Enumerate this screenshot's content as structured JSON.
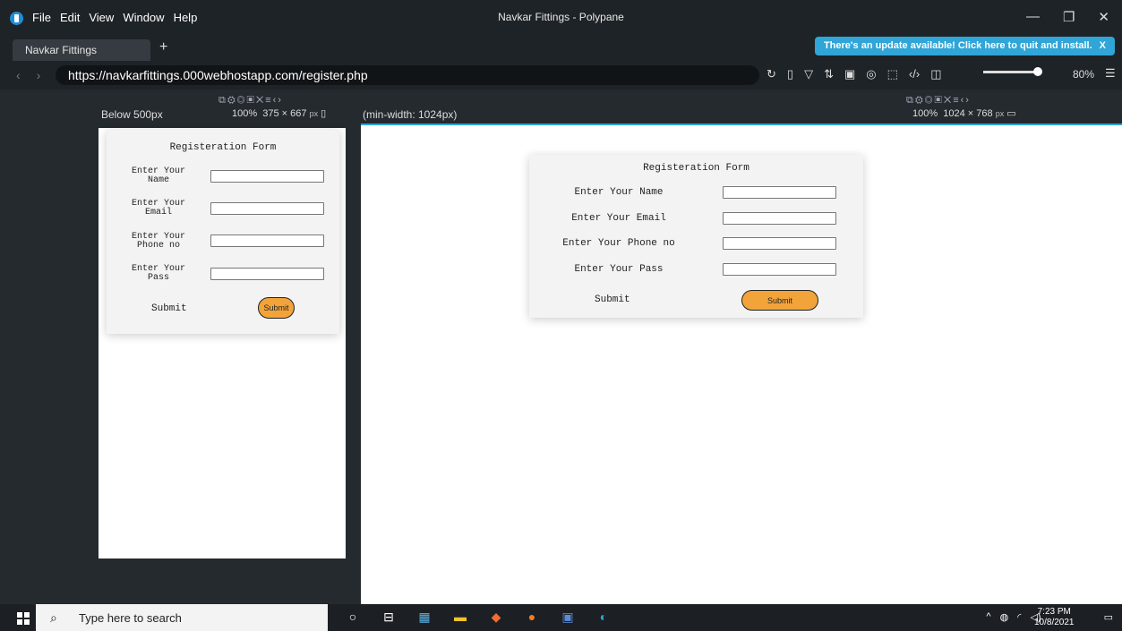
{
  "window": {
    "title": "Navkar Fittings - Polypane"
  },
  "menu": [
    "File",
    "Edit",
    "View",
    "Window",
    "Help"
  ],
  "tab": {
    "label": "Navkar Fittings",
    "add": "+"
  },
  "update_banner": {
    "text": "There's an update available! Click here to quit and install.",
    "close": "X"
  },
  "url": "https://navkarfittings.000webhostapp.com/register.php",
  "zoom": "80%",
  "panes": {
    "left": {
      "label": "Below 500px",
      "scale": "100%",
      "size": "375 × 667",
      "unit": "px"
    },
    "right": {
      "label": "(min-width: 1024px)",
      "scale": "100%",
      "size": "1024 × 768",
      "unit": "px"
    }
  },
  "form": {
    "title": "Registeration Form",
    "labels_short": [
      "Enter Your\nName",
      "Enter Your\nEmail",
      "Enter Your\nPhone no",
      "Enter Your\nPass"
    ],
    "labels": [
      "Enter Your Name",
      "Enter Your Email",
      "Enter Your Phone no",
      "Enter Your Pass"
    ],
    "submit_label": "Submit",
    "submit_button": "Submit"
  },
  "taskbar": {
    "search_placeholder": "Type here to search",
    "time": "7:23 PM",
    "date": "10/8/2021"
  },
  "colors": {
    "accent": "#2fa5d8",
    "button": "#f2a43a"
  }
}
